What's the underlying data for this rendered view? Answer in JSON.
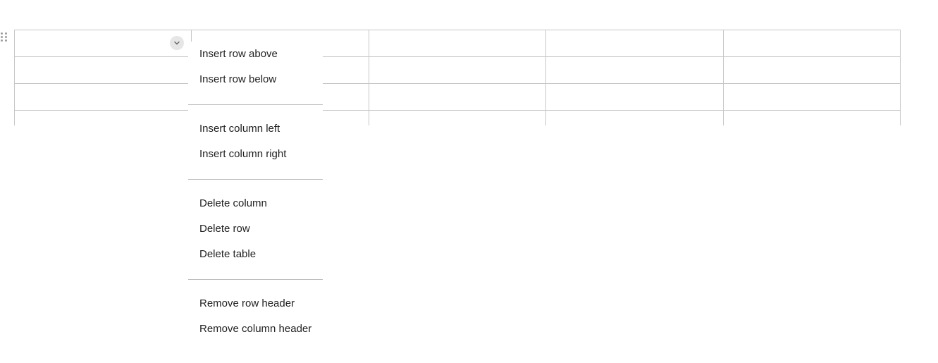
{
  "table": {
    "rows": [
      [
        "",
        "",
        "",
        "",
        ""
      ],
      [
        "",
        "",
        "",
        "",
        ""
      ],
      [
        "",
        "",
        "",
        "",
        ""
      ],
      [
        "",
        "",
        "",
        "",
        ""
      ]
    ]
  },
  "cell_menu_button": {
    "icon": "chevron-down-icon"
  },
  "context_menu": {
    "groups": [
      {
        "items": [
          {
            "name": "insert-row-above",
            "label": "Insert row above"
          },
          {
            "name": "insert-row-below",
            "label": "Insert row below"
          }
        ]
      },
      {
        "items": [
          {
            "name": "insert-column-left",
            "label": "Insert column left"
          },
          {
            "name": "insert-column-right",
            "label": "Insert column right"
          }
        ]
      },
      {
        "items": [
          {
            "name": "delete-column",
            "label": "Delete column"
          },
          {
            "name": "delete-row",
            "label": "Delete row"
          },
          {
            "name": "delete-table",
            "label": "Delete table"
          }
        ]
      },
      {
        "items": [
          {
            "name": "remove-row-header",
            "label": "Remove row header"
          },
          {
            "name": "remove-column-header",
            "label": "Remove column header"
          }
        ]
      }
    ]
  }
}
